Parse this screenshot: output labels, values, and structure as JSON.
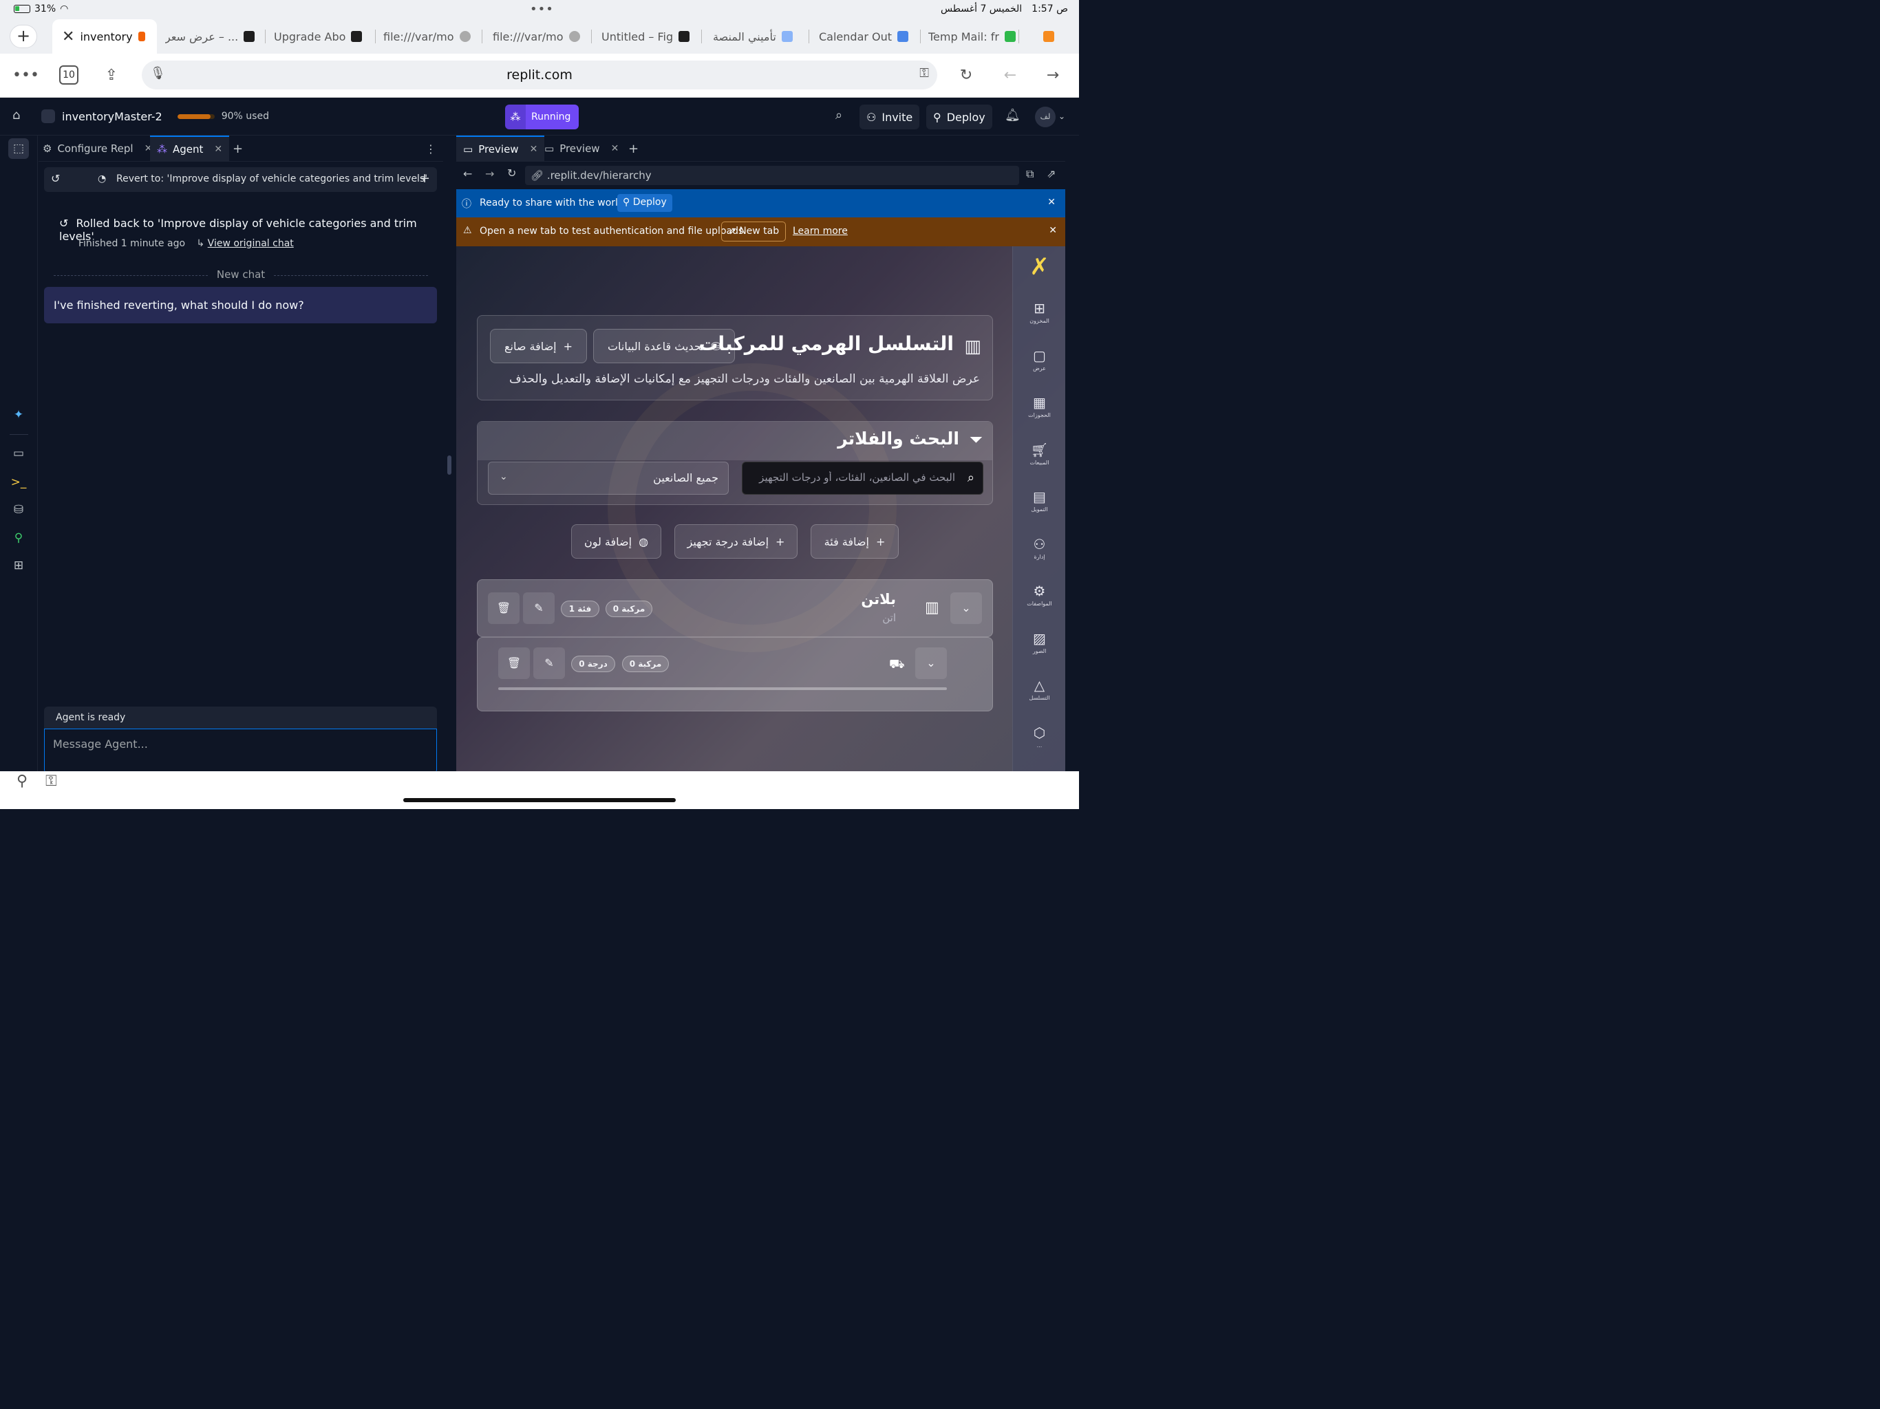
{
  "status_bar": {
    "battery": "31%",
    "dots": "•••",
    "time": "1:57 ص",
    "date": "الخميس 7 أغسطس"
  },
  "browser": {
    "tabs": [
      {
        "label": "inventory",
        "active": true
      },
      {
        "label": "عرض سعر – ..."
      },
      {
        "label": "Upgrade Abo"
      },
      {
        "label": "file:///var/mo"
      },
      {
        "label": "file:///var/mo"
      },
      {
        "label": "Untitled – Fig"
      },
      {
        "label": "تأميني المنصة"
      },
      {
        "label": "Calendar Out"
      },
      {
        "label": "Temp Mail: fr"
      }
    ],
    "tab_count": "10",
    "url": "replit.com"
  },
  "replit": {
    "project_name": "inventoryMaster-2",
    "usage_fraction": 0.9,
    "usage_text": "90% used",
    "running_label": "Running",
    "invite_label": "Invite",
    "deploy_label": "Deploy",
    "user_initials": "لف",
    "colors": {
      "accent": "#0079f2",
      "running": "#6f48f4",
      "usage": "#c86b10"
    }
  },
  "agent_pane": {
    "tabs": [
      {
        "label": "Configure Repl"
      },
      {
        "label": "Agent",
        "active": true
      }
    ],
    "revert_text": "Revert to: 'Improve display of vehicle categories and trim levels'",
    "rolled_back_text": "Rolled back to 'Improve display of vehicle categories and trim levels'",
    "finished_text": "Finished 1 minute ago",
    "view_original": "View original chat",
    "new_chat_label": "New chat",
    "user_message": "I've finished reverting, what should I do now?",
    "status": "Agent is ready",
    "input_placeholder": "Message Agent..."
  },
  "preview_pane": {
    "tabs": [
      {
        "label": "Preview",
        "active": true
      },
      {
        "label": "Preview"
      }
    ],
    "address": ".replit.dev/hierarchy",
    "deploy_banner": {
      "text": "Ready to share with the world?",
      "button": "Deploy"
    },
    "auth_banner": {
      "text": "Open a new tab to test authentication and file uploads.",
      "button": "New tab",
      "link": "Learn more"
    }
  },
  "app": {
    "title": "التسلسل الهرمي للمركبات",
    "subtitle": "عرض العلاقة الهرمية بين الصانعين والفئات ودرجات التجهيز مع إمكانيات الإضافة والتعديل والحذف",
    "refresh_db": "تحديث قاعدة البيانات",
    "add_maker": "إضافة صانع",
    "filters_title": "البحث والفلاتر",
    "search_placeholder": "البحث في الصانعين، الفئات، أو درجات التجهيز",
    "maker_select": "جميع الصانعين",
    "add_category": "إضافة فئة",
    "add_trim": "إضافة درجة تجهيز",
    "add_color": "إضافة لون",
    "maker": {
      "name": "بلاتن",
      "sub": "اتن",
      "vehicles_badge": "0 مركبة",
      "categories_badge": "1 فئة"
    },
    "category": {
      "vehicles_badge": "0 مركبة",
      "trims_badge": "0 درجة"
    },
    "sidebar": [
      {
        "icon": "grid-icon",
        "label": "المخزون"
      },
      {
        "icon": "chat-icon",
        "label": "عرض"
      },
      {
        "icon": "calendar-icon",
        "label": "الحجوزات"
      },
      {
        "icon": "cart-icon",
        "label": "المبيعات"
      },
      {
        "icon": "calculator-icon",
        "label": "التمويل"
      },
      {
        "icon": "user-check-icon",
        "label": "إدارة"
      },
      {
        "icon": "gear-icon",
        "label": "المواصفات"
      },
      {
        "icon": "image-icon",
        "label": "الصور"
      },
      {
        "icon": "tree-icon",
        "label": "التسلسل"
      },
      {
        "icon": "box-icon",
        "label": "..."
      }
    ]
  }
}
